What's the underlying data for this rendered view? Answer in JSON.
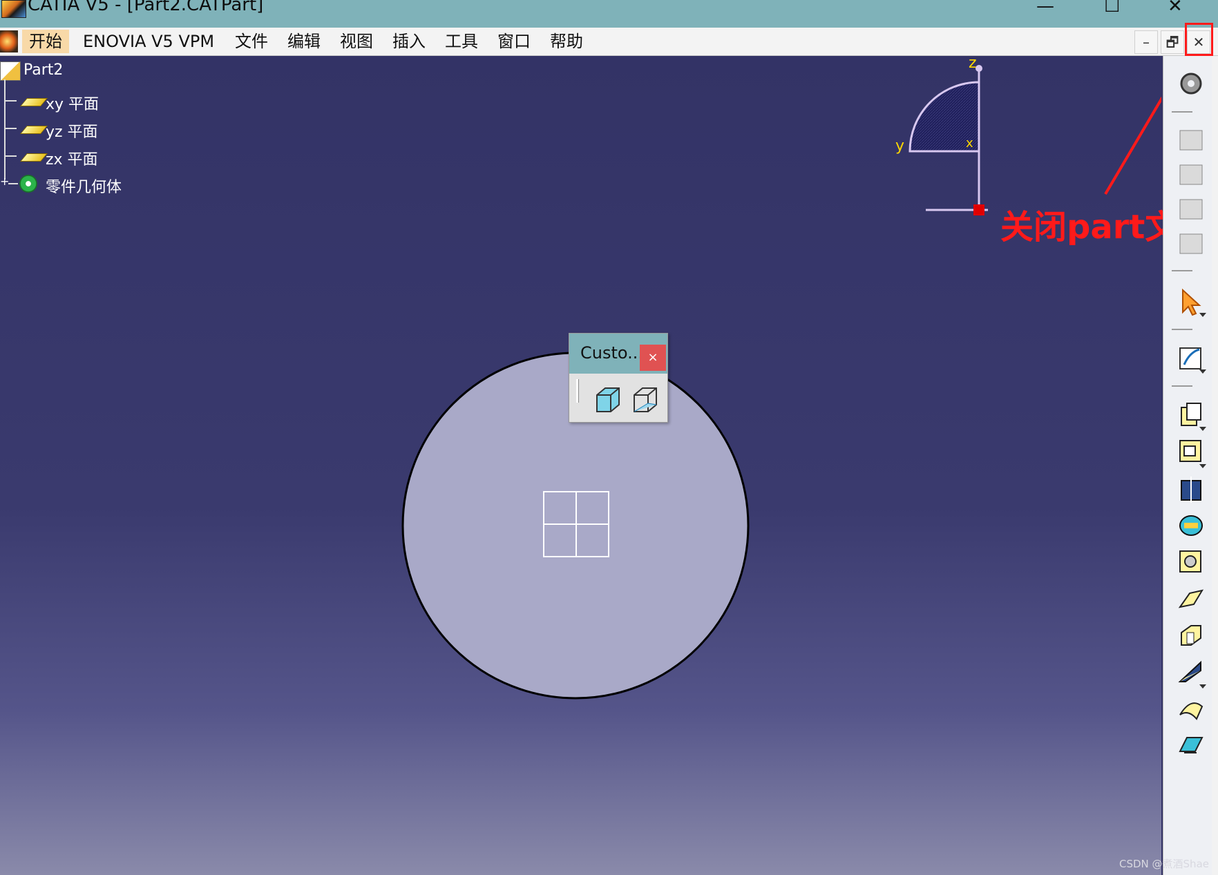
{
  "window": {
    "title": "CATIA V5 - [Part2.CATPart]",
    "controls": {
      "minimize": "—",
      "maximize": "☐",
      "close": "✕"
    }
  },
  "menubar": {
    "items": [
      "开始",
      "ENOVIA V5 VPM",
      "文件",
      "编辑",
      "视图",
      "插入",
      "工具",
      "窗口",
      "帮助"
    ],
    "doc_controls": {
      "minimize": "–",
      "restore": "🗗",
      "close": "✕"
    }
  },
  "tree": {
    "root": "Part2",
    "children": [
      "xy 平面",
      "yz 平面",
      "zx 平面",
      "零件几何体"
    ]
  },
  "compass": {
    "axes": {
      "z": "z",
      "y": "y",
      "x": "x"
    }
  },
  "annotation": {
    "text": "关闭part文件",
    "color": "#ff1a1a"
  },
  "dialog": {
    "title": "Custo...",
    "close": "×",
    "buttons": [
      "shaded-view-icon",
      "wireframe-view-icon"
    ]
  },
  "right_toolbar": {
    "buttons": [
      "gear-icon",
      "sketch-tool-icon",
      "sketch-tool-icon",
      "sketch-tool-icon",
      "sketch-tool-icon",
      "select-arrow-icon",
      "sketcher-icon",
      "pad-icon",
      "pocket-icon",
      "shaft-icon",
      "groove-icon",
      "hole-icon",
      "rib-icon",
      "slot-icon",
      "stiffener-icon",
      "multisection-icon",
      "remove-multisection-icon"
    ]
  },
  "watermark": "CSDN @煮酒Shae",
  "colors": {
    "titlebar": "#7fb2b9",
    "background": "#333366",
    "part_fill": "#a9a9c8",
    "accent_red": "#ff1a1a"
  }
}
